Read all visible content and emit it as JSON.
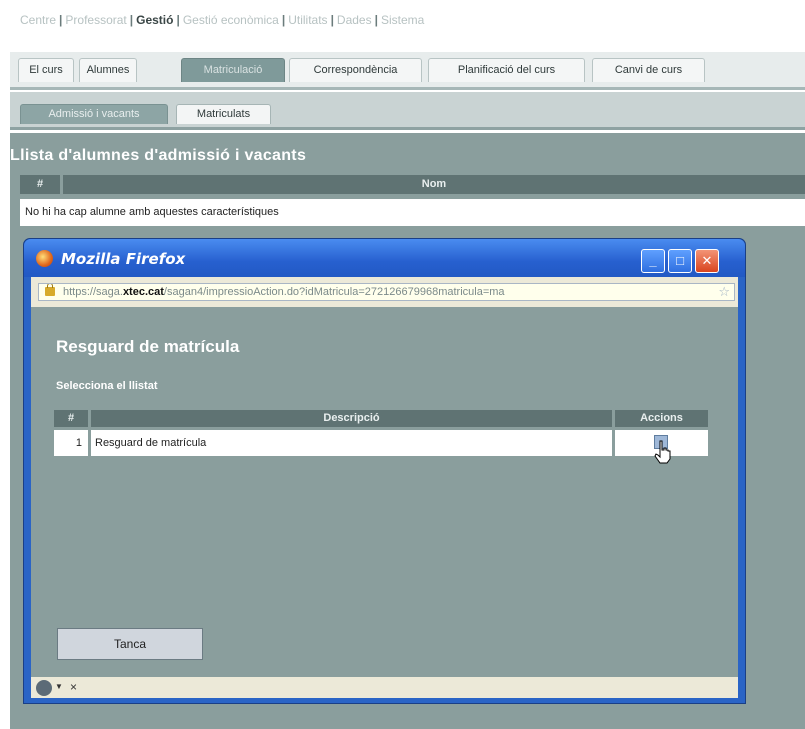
{
  "topnav": {
    "items": [
      {
        "label": "Centre"
      },
      {
        "label": "Professorat"
      },
      {
        "label": "Gestió"
      },
      {
        "label": "Gestió econòmica"
      },
      {
        "label": "Utilitats"
      },
      {
        "label": "Dades"
      },
      {
        "label": "Sistema"
      }
    ],
    "separator": "|"
  },
  "tabs": [
    {
      "label": "El curs"
    },
    {
      "label": "Alumnes"
    },
    {
      "label": "Matriculació"
    },
    {
      "label": "Correspondència"
    },
    {
      "label": "Planificació del curs"
    },
    {
      "label": "Canvi de curs"
    }
  ],
  "subtabs": [
    {
      "label": "Admissió i vacants"
    },
    {
      "label": "Matriculats"
    }
  ],
  "main": {
    "title": "Llista d'alumnes d'admissió i vacants",
    "columns": [
      "#",
      "Nom"
    ],
    "empty_message": "No hi ha cap alumne amb aquestes característiques"
  },
  "popup": {
    "window_title": "Mozilla Firefox",
    "url_prefix": "https://saga.",
    "url_domain": "xtec.cat",
    "url_rest": "/sagan4/impressioAction.do?idMatricula=272126679968matricula=ma",
    "page_title": "Resguard de matrícula",
    "subtitle": "Selecciona el llistat",
    "columns": [
      "#",
      "Descripció",
      "Accions"
    ],
    "rows": [
      {
        "num": "1",
        "description": "Resguard de matrícula"
      }
    ],
    "close_label": "Tanca",
    "status_close": "×",
    "minimize_glyph": "_",
    "maximize_glyph": "□",
    "close_glyph": "✕",
    "star_glyph": "☆"
  },
  "colors": {
    "accent": "#8a9e9d",
    "header": "#5f7373",
    "titlebar": "#2a64c6"
  },
  "icons": [
    "firefox-logo-icon",
    "lock-icon",
    "bookmark-star-icon",
    "print-icon",
    "hand-cursor-icon",
    "status-icon"
  ]
}
